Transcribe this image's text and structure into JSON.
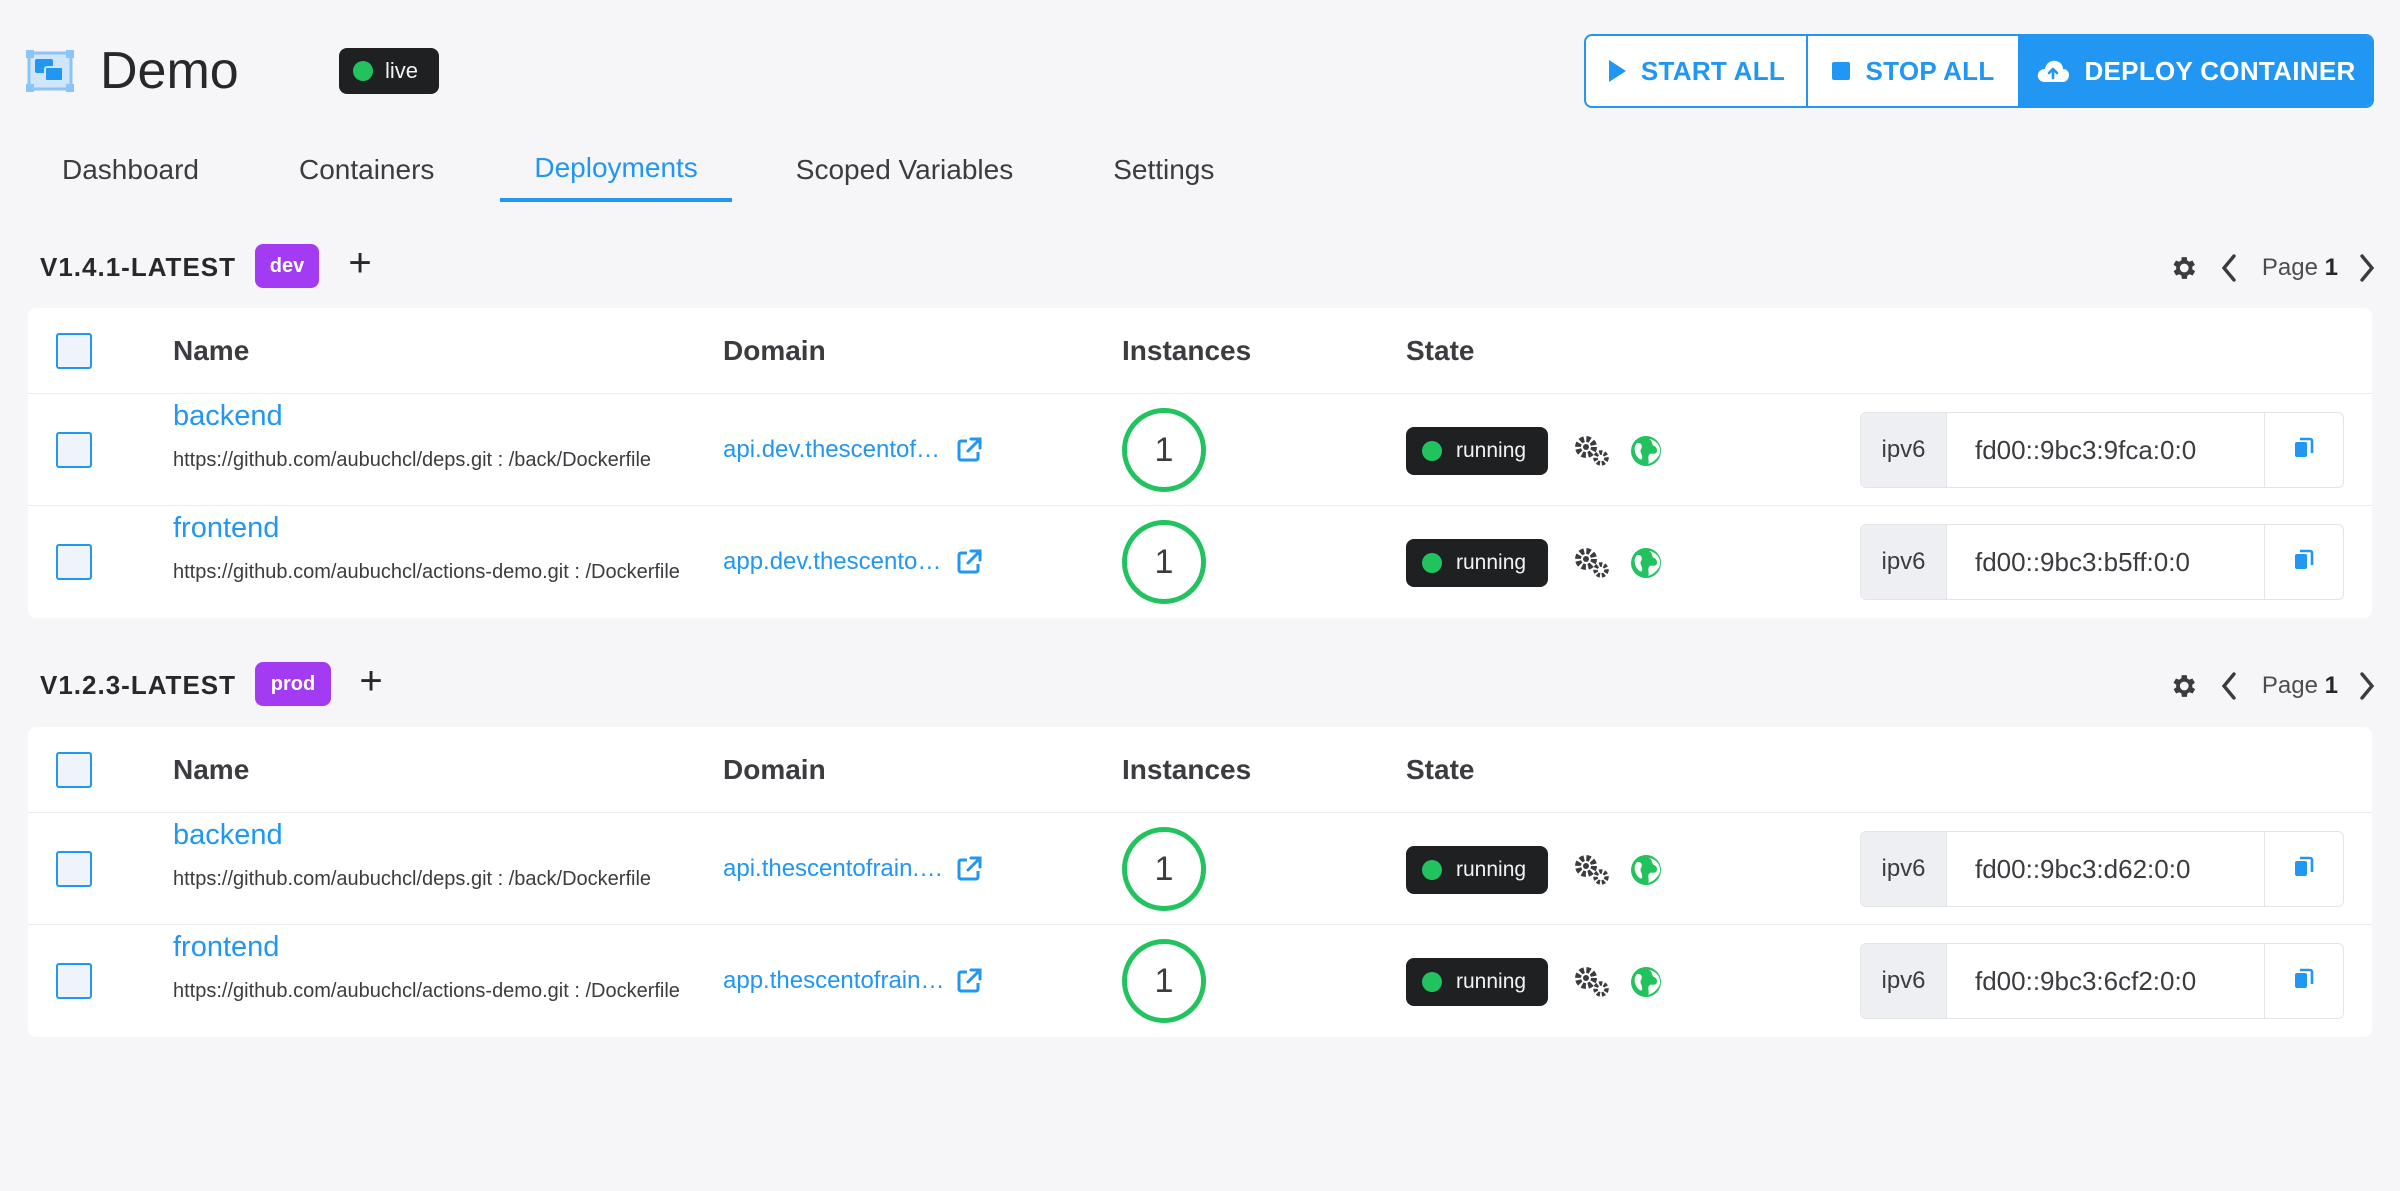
{
  "header": {
    "app_title": "Demo",
    "status_badge": "live",
    "actions": {
      "start_all": "START ALL",
      "stop_all": "STOP ALL",
      "deploy_container": "DEPLOY CONTAINER"
    }
  },
  "tabs": [
    "Dashboard",
    "Containers",
    "Deployments",
    "Scoped Variables",
    "Settings"
  ],
  "active_tab": "Deployments",
  "columns": {
    "name": "Name",
    "domain": "Domain",
    "instances": "Instances",
    "state": "State"
  },
  "groups": [
    {
      "version": "V1.4.1-LATEST",
      "env": "dev",
      "pager": {
        "label": "Page",
        "page": "1"
      },
      "rows": [
        {
          "name": "backend",
          "repo": "https://github.com/aubuchcl/deps.git : /back/Dockerfile",
          "domain": "api.dev.thescentofrain.com",
          "instances": "1",
          "state": "running",
          "ip_label": "ipv6",
          "ip": "fd00::9bc3:9fca:0:0"
        },
        {
          "name": "frontend",
          "repo": "https://github.com/aubuchcl/actions-demo.git : /Dockerfile",
          "domain": "app.dev.thescentofrain.com",
          "instances": "1",
          "state": "running",
          "ip_label": "ipv6",
          "ip": "fd00::9bc3:b5ff:0:0"
        }
      ]
    },
    {
      "version": "V1.2.3-LATEST",
      "env": "prod",
      "pager": {
        "label": "Page",
        "page": "1"
      },
      "rows": [
        {
          "name": "backend",
          "repo": "https://github.com/aubuchcl/deps.git : /back/Dockerfile",
          "domain": "api.thescentofrain.com",
          "instances": "1",
          "state": "running",
          "ip_label": "ipv6",
          "ip": "fd00::9bc3:d62:0:0"
        },
        {
          "name": "frontend",
          "repo": "https://github.com/aubuchcl/actions-demo.git : /Dockerfile",
          "domain": "app.thescentofrain.com",
          "instances": "1",
          "state": "running",
          "ip_label": "ipv6",
          "ip": "fd00::9bc3:6cf2:0:0"
        }
      ]
    }
  ],
  "icons": {
    "app": "container-app-icon",
    "start": "play-icon",
    "stop": "stop-icon",
    "deploy": "cloud-upload-icon",
    "external": "external-link-icon",
    "cogs": "cogs-icon",
    "globe": "globe-icon",
    "copy": "copy-icon",
    "settings": "gear-icon",
    "prev": "chevron-left-icon",
    "next": "chevron-right-icon",
    "add": "plus-icon"
  },
  "colors": {
    "accent": "#2196f3",
    "success": "#22c35e",
    "env_badge": "#a23bf2",
    "dark_badge": "#1f2021"
  }
}
